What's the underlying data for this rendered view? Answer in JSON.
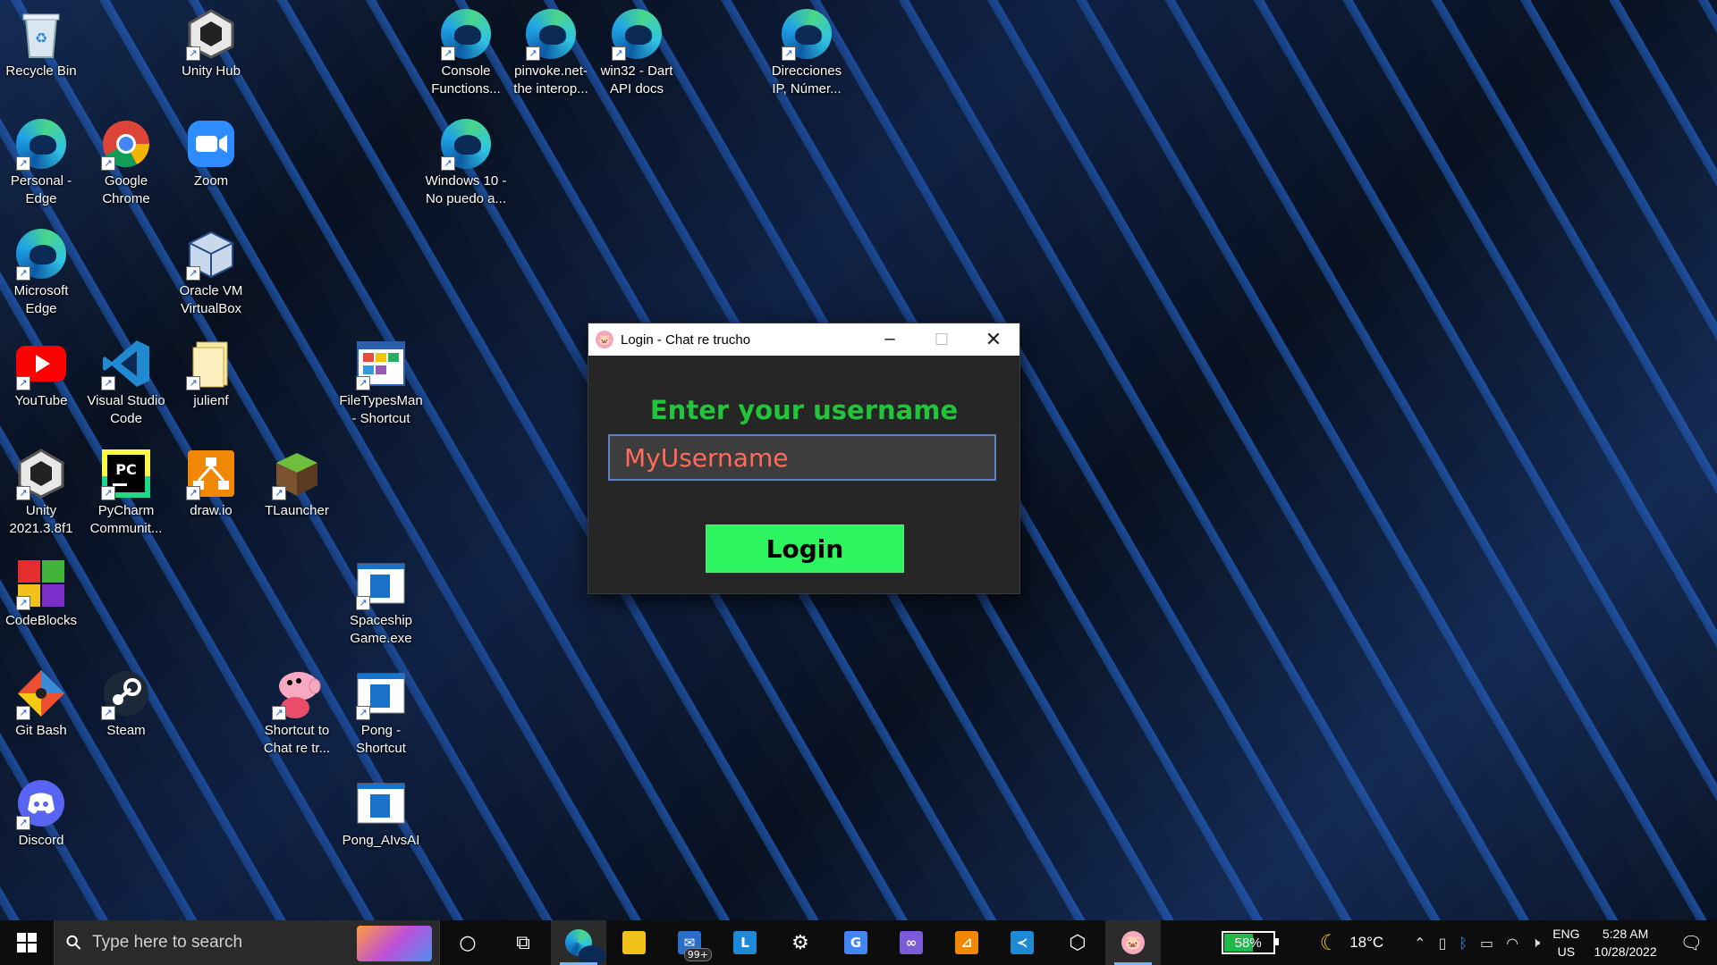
{
  "desktop": {
    "icons": [
      {
        "label": "Recycle Bin",
        "icon": "recycle-bin-icon"
      },
      {
        "label": "Unity Hub",
        "icon": "unity-hub-icon"
      },
      {
        "label": "Console\nFunctions...",
        "icon": "edge-icon"
      },
      {
        "label": "pinvoke.net-\nthe interop...",
        "icon": "edge-icon"
      },
      {
        "label": "win32 - Dart\nAPI docs",
        "icon": "edge-icon"
      },
      {
        "label": "Direcciones\nIP, Númer...",
        "icon": "edge-icon"
      },
      {
        "label": "Personal -\nEdge",
        "icon": "edge-icon"
      },
      {
        "label": "Google\nChrome",
        "icon": "chrome-icon"
      },
      {
        "label": "Zoom",
        "icon": "zoom-icon"
      },
      {
        "label": "Windows 10 -\nNo puedo a...",
        "icon": "edge-icon"
      },
      {
        "label": "Microsoft\nEdge",
        "icon": "edge-icon"
      },
      {
        "label": "Oracle VM\nVirtualBox",
        "icon": "virtualbox-icon"
      },
      {
        "label": "YouTube",
        "icon": "youtube-icon"
      },
      {
        "label": "Visual Studio\nCode",
        "icon": "vscode-icon"
      },
      {
        "label": "julienf",
        "icon": "folder-icon"
      },
      {
        "label": "FileTypesMan\n- Shortcut",
        "icon": "filetypesman-icon"
      },
      {
        "label": "Unity\n2021.3.8f1",
        "icon": "unity-icon"
      },
      {
        "label": "PyCharm\nCommunit...",
        "icon": "pycharm-icon"
      },
      {
        "label": "draw.io",
        "icon": "drawio-icon"
      },
      {
        "label": "TLauncher",
        "icon": "tlauncher-icon"
      },
      {
        "label": "CodeBlocks",
        "icon": "codeblocks-icon"
      },
      {
        "label": "Spaceship\nGame.exe",
        "icon": "app-window-icon"
      },
      {
        "label": "Git Bash",
        "icon": "git-bash-icon"
      },
      {
        "label": "Steam",
        "icon": "steam-icon"
      },
      {
        "label": "Shortcut to\nChat re tr...",
        "icon": "peppa-icon"
      },
      {
        "label": "Pong -\nShortcut",
        "icon": "app-window-icon"
      },
      {
        "label": "Discord",
        "icon": "discord-icon"
      },
      {
        "label": "Pong_AIvsAI",
        "icon": "app-window-icon"
      }
    ]
  },
  "window": {
    "title": "Login - Chat re trucho",
    "heading": "Enter your username",
    "username_value": "MyUsername",
    "login_label": "Login",
    "colors": {
      "heading": "#22c43a",
      "input_text": "#ff6a5a",
      "button": "#2df45f",
      "background": "#262626"
    }
  },
  "taskbar": {
    "search_placeholder": "Type here to search",
    "mail_badge": "99+",
    "battery": "58%",
    "battery_level": 0.58,
    "temperature": "18°C",
    "lang_line1": "ENG",
    "lang_line2": "US",
    "time": "5:28 AM",
    "date": "10/28/2022"
  }
}
